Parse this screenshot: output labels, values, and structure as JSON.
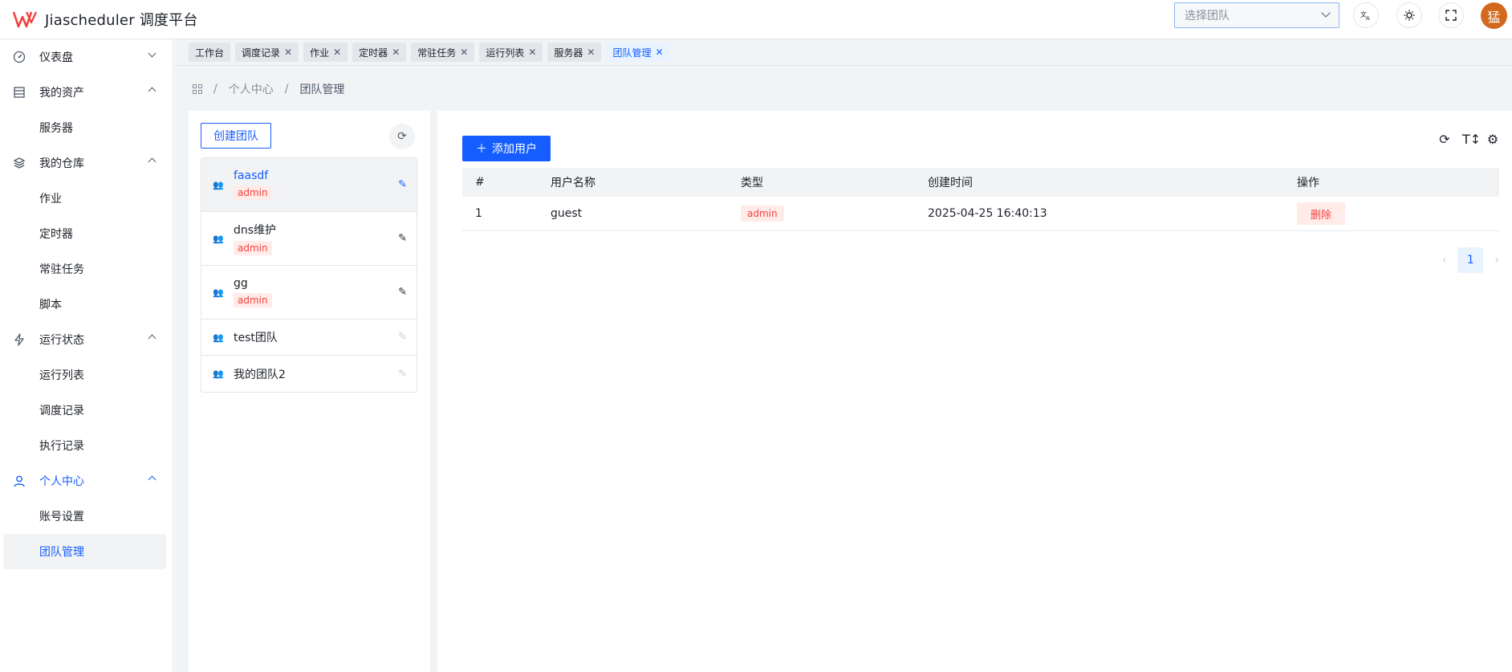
{
  "header": {
    "app_title": "Jiascheduler 调度平台",
    "team_select_placeholder": "选择团队",
    "avatar_text": "猛"
  },
  "sidebar": {
    "groups": [
      {
        "label": "仪表盘",
        "icon": "dashboard-icon",
        "expanded": false,
        "items": []
      },
      {
        "label": "我的资产",
        "icon": "assets-icon",
        "expanded": true,
        "items": [
          "服务器"
        ]
      },
      {
        "label": "我的仓库",
        "icon": "layers-icon",
        "expanded": true,
        "items": [
          "作业",
          "定时器",
          "常驻任务",
          "脚本"
        ]
      },
      {
        "label": "运行状态",
        "icon": "lightning-icon",
        "expanded": true,
        "items": [
          "运行列表",
          "调度记录",
          "执行记录"
        ]
      },
      {
        "label": "个人中心",
        "icon": "user-icon",
        "expanded": true,
        "items": [
          "账号设置",
          "团队管理"
        ]
      }
    ],
    "active_item": "团队管理"
  },
  "tabs": [
    {
      "label": "工作台",
      "closable": false
    },
    {
      "label": "调度记录",
      "closable": true
    },
    {
      "label": "作业",
      "closable": true
    },
    {
      "label": "定时器",
      "closable": true
    },
    {
      "label": "常驻任务",
      "closable": true
    },
    {
      "label": "运行列表",
      "closable": true
    },
    {
      "label": "服务器",
      "closable": true
    },
    {
      "label": "团队管理",
      "closable": true,
      "active": true
    }
  ],
  "breadcrumb": {
    "items": [
      "个人中心",
      "团队管理"
    ]
  },
  "team_panel": {
    "create_label": "创建团队",
    "teams": [
      {
        "name": "faasdf",
        "tag": "admin",
        "editable": true,
        "active": true
      },
      {
        "name": "dns维护",
        "tag": "admin",
        "editable": true
      },
      {
        "name": "gg",
        "tag": "admin",
        "editable": true
      },
      {
        "name": "test团队",
        "tag": "",
        "editable": false
      },
      {
        "name": "我的团队2",
        "tag": "",
        "editable": false
      }
    ]
  },
  "user_panel": {
    "add_label": "添加用户",
    "columns": [
      "#",
      "用户名称",
      "类型",
      "创建时间",
      "操作"
    ],
    "rows": [
      {
        "index": "1",
        "username": "guest",
        "type": "admin",
        "created_at": "2025-04-25 16:40:13",
        "action": "删除"
      }
    ],
    "page": "1"
  },
  "colors": {
    "primary": "#165dff",
    "danger": "#f53f3f",
    "danger_bg": "#ffece8",
    "avatar_bg": "#d3691e"
  }
}
